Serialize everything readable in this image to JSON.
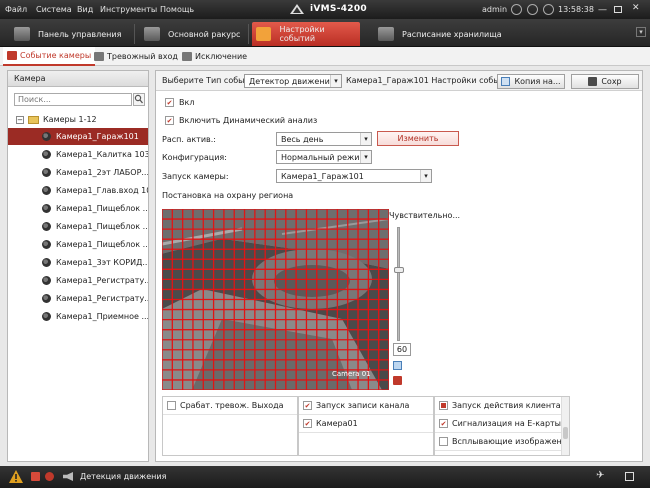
{
  "titlebar": {
    "menu": [
      "Файл",
      "Система",
      "Вид",
      "Инструменты",
      "Помощь"
    ],
    "app_title": "iVMS-4200",
    "user": "admin",
    "clock": "13:58:38"
  },
  "main_tabs": [
    {
      "label": "Панель управления",
      "icon": "control-panel-icon"
    },
    {
      "label": "Основной ракурс",
      "icon": "main-view-icon"
    },
    {
      "label": "Настройки событий",
      "icon": "event-settings-icon"
    },
    {
      "label": "Расписание хранилища",
      "icon": "storage-schedule-icon"
    }
  ],
  "sub_tabs": [
    "Событие камеры",
    "Тревожный вход",
    "Исключение"
  ],
  "left_panel": {
    "header": "Камера",
    "search_placeholder": "Поиск...",
    "group": "Камеры 1-12",
    "cameras": [
      "Камера1_Гараж101",
      "Камера1_Калитка 103",
      "Камера1_2эт ЛАБОР...",
      "Камера1_Глав.вход 105",
      "Камера1_Пищеблок ...",
      "Камера1_Пищеблок ...",
      "Камера1_Пищеблок ...",
      "Камера1_3эт КОРИД...",
      "Камера1_Регистрату...",
      "Камера1_Регистрату...",
      "Камера1_Приемное ..."
    ],
    "selected_index": 0
  },
  "toolbar": {
    "event_type_label": "Выберите Тип собы...",
    "event_type_value": "Детектор движения",
    "settings_title": "Камера1_Гараж101 Настройки событий",
    "copy_button": "Копия на...",
    "save_button": "Сохр"
  },
  "settings": {
    "enable_label": "Вкл",
    "enable_checked": true,
    "dynamic_label": "Включить Динамический анализ",
    "dynamic_checked": true,
    "schedule_label": "Расп. актив.:",
    "schedule_value": "Весь день",
    "edit_button": "Изменить",
    "config_label": "Конфигурация:",
    "config_value": "Нормальный режим",
    "camera_label": "Запуск камеры:",
    "camera_value": "Камера1_Гараж101",
    "region_label": "Постановка на охрану региона",
    "sensitivity_label": "Чувствительно...",
    "sensitivity_value": "60",
    "video_overlay_text": "Camera 01"
  },
  "actions": {
    "alarm_output": {
      "label": "Срабат. тревож. Выхода",
      "checked": false
    },
    "record_header": {
      "label": "Запуск записи канала",
      "checked": true
    },
    "record_channels": [
      {
        "label": "Камера01",
        "checked": true
      }
    ],
    "client_header": {
      "label": "Запуск действия клиента",
      "checked": "partial"
    },
    "client_items": [
      {
        "label": "Сигнализация на E-карты",
        "checked": true
      },
      {
        "label": "Всплывающие изображен...",
        "checked": false
      }
    ]
  },
  "statusbar": {
    "text": "Детекция движения"
  },
  "colors": {
    "accent": "#c0392b",
    "selection": "#9b2b24",
    "grid": "#e01515"
  }
}
